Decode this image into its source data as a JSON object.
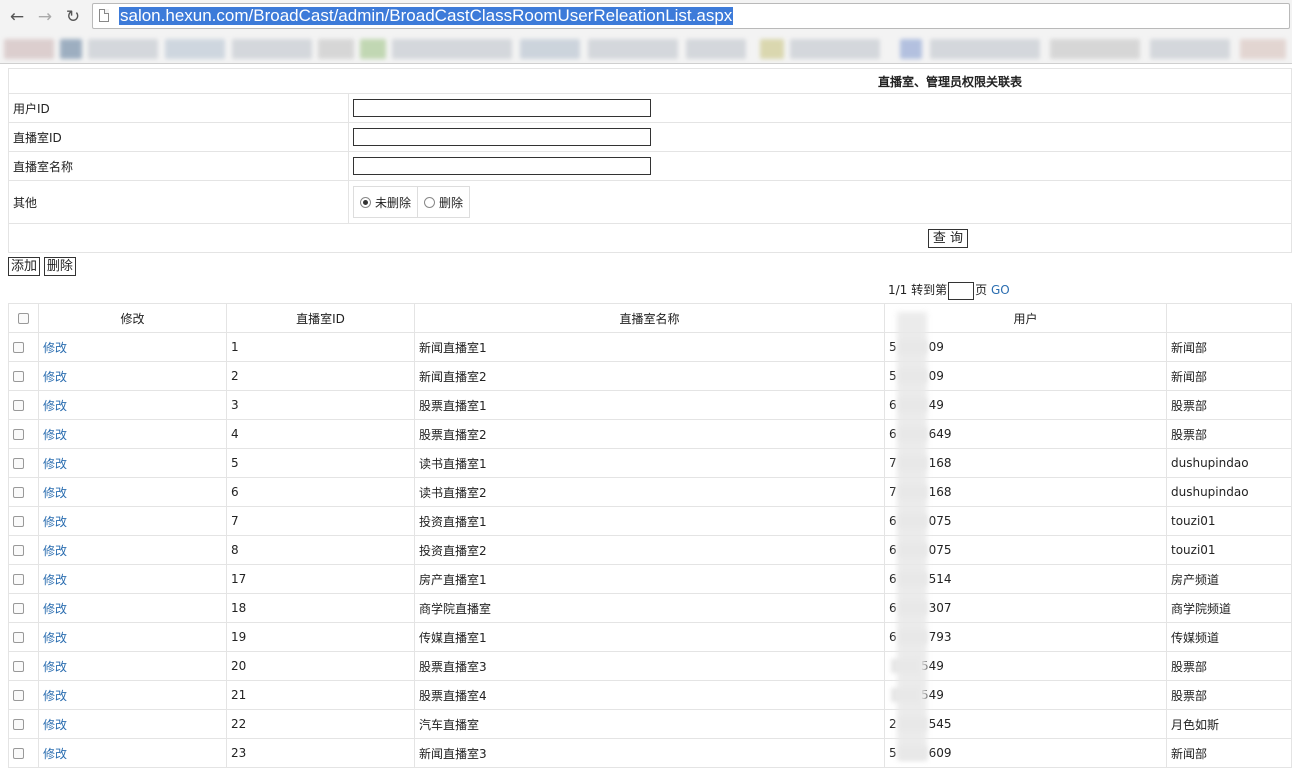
{
  "browser": {
    "back_icon": "back-arrow-icon",
    "forward_icon": "forward-arrow-icon",
    "reload_icon": "reload-icon",
    "url": "salon.hexun.com/BroadCast/admin/BroadCastClassRoomUserReleationList.aspx"
  },
  "form": {
    "title": "直播室、管理员权限关联表",
    "user_id_label": "用户ID",
    "room_id_label": "直播室ID",
    "room_name_label": "直播室名称",
    "other_label": "其他",
    "radio_not_deleted": "未删除",
    "radio_deleted": "删除",
    "selected_radio": "未删除",
    "query_button": "查 询"
  },
  "toolbar": {
    "add_button": "添加",
    "delete_button": "删除"
  },
  "pager": {
    "page_status": "1/1",
    "goto_prefix": "转到第",
    "goto_suffix": "页",
    "go_link": "GO"
  },
  "table": {
    "headers": [
      "修改",
      "直播室ID",
      "直播室名称",
      "用户"
    ],
    "edit_label": "修改",
    "rows": [
      {
        "room_id": "1",
        "room_name": "新闻直播室1",
        "user_pre": "5",
        "user_post": "09",
        "dept": "新闻部"
      },
      {
        "room_id": "2",
        "room_name": "新闻直播室2",
        "user_pre": "5",
        "user_post": "09",
        "dept": "新闻部"
      },
      {
        "room_id": "3",
        "room_name": "股票直播室1",
        "user_pre": "6",
        "user_post": "49",
        "dept": "股票部"
      },
      {
        "room_id": "4",
        "room_name": "股票直播室2",
        "user_pre": "6",
        "user_post": "649",
        "dept": "股票部"
      },
      {
        "room_id": "5",
        "room_name": "读书直播室1",
        "user_pre": "7",
        "user_post": "168",
        "dept": "dushupindao"
      },
      {
        "room_id": "6",
        "room_name": "读书直播室2",
        "user_pre": "7",
        "user_post": "168",
        "dept": "dushupindao"
      },
      {
        "room_id": "7",
        "room_name": "投资直播室1",
        "user_pre": "6",
        "user_post": "075",
        "dept": "touzi01"
      },
      {
        "room_id": "8",
        "room_name": "投资直播室2",
        "user_pre": "6",
        "user_post": "075",
        "dept": "touzi01"
      },
      {
        "room_id": "17",
        "room_name": "房产直播室1",
        "user_pre": "6",
        "user_post": "514",
        "dept": "房产频道"
      },
      {
        "room_id": "18",
        "room_name": "商学院直播室",
        "user_pre": "6",
        "user_post": "307",
        "dept": "商学院频道"
      },
      {
        "room_id": "19",
        "room_name": "传媒直播室1",
        "user_pre": "6",
        "user_post": "793",
        "dept": "传媒频道"
      },
      {
        "room_id": "20",
        "room_name": "股票直播室3",
        "user_pre": "",
        "user_post": "549",
        "dept": "股票部"
      },
      {
        "room_id": "21",
        "room_name": "股票直播室4",
        "user_pre": "",
        "user_post": "549",
        "dept": "股票部"
      },
      {
        "room_id": "22",
        "room_name": "汽车直播室",
        "user_pre": "2",
        "user_post": "545",
        "dept": "月色如斯"
      },
      {
        "room_id": "23",
        "room_name": "新闻直播室3",
        "user_pre": "5",
        "user_post": "609",
        "dept": "新闻部"
      }
    ]
  }
}
